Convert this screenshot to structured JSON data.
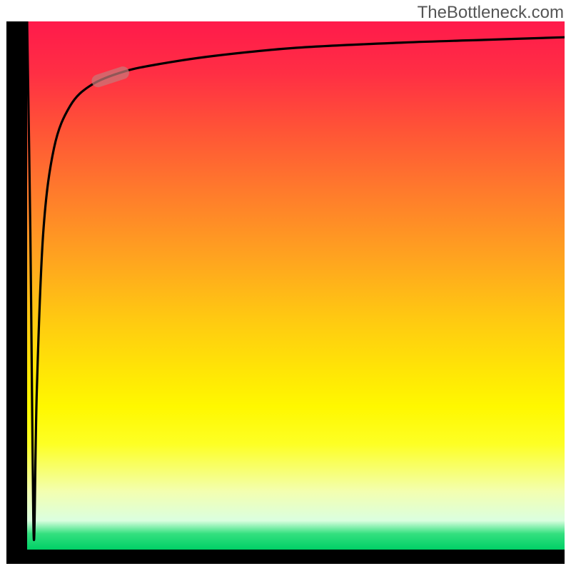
{
  "attribution": "TheBottleneck.com",
  "colors": {
    "frame": "#000000",
    "curve": "#000000",
    "marker": "rgba(200,120,120,0.72)",
    "gradient_stops": [
      "#ff1a4b",
      "#ff2f44",
      "#ff5237",
      "#ff7a2c",
      "#ffa41f",
      "#ffc812",
      "#ffe506",
      "#fff800",
      "#fdff24",
      "#f3ffb0",
      "#dbffe0",
      "#33e07f",
      "#00d066"
    ]
  },
  "chart_data": {
    "type": "line",
    "title": "",
    "xlabel": "",
    "ylabel": "",
    "xlim": [
      0,
      100
    ],
    "ylim": [
      0,
      100
    ],
    "grid": false,
    "legend": false,
    "notes": "No axis tick labels are shown in the image; x and y ranges are normalized 0–100 to describe the curve shape. y increases upward. Curve drops sharply from ~100 at x≈0 to ~2 at x≈1.3, then rises steeply and asymptotes near y≈95–97.",
    "series": [
      {
        "name": "bottleneck-curve",
        "x": [
          0,
          0.6,
          1.0,
          1.3,
          1.8,
          3,
          5,
          8,
          12,
          18,
          25,
          35,
          50,
          70,
          85,
          100
        ],
        "y": [
          100,
          60,
          20,
          2,
          30,
          60,
          76,
          84,
          88,
          90.5,
          92,
          93.5,
          95,
          96,
          96.5,
          97
        ]
      }
    ],
    "annotations": [
      {
        "name": "highlight-pill",
        "shape": "rounded-rect-rotated",
        "cx": 15.5,
        "cy": 89.5,
        "width": 7.2,
        "height": 2.4,
        "angle_deg": 18
      }
    ]
  }
}
